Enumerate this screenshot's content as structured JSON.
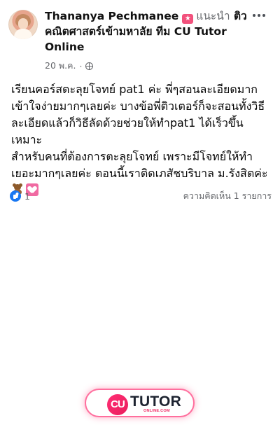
{
  "post": {
    "author_name": "Thananya Pechmanee",
    "recommendation_label": "แนะนำ",
    "page_name_prefix": "ติว",
    "page_name_line2": "คณิตศาสตร์เข้ามหาลัย ทีม CU Tutor",
    "page_name_line3": "Online",
    "date": "20 พ.ค.",
    "separator": "·",
    "visibility_icon": "globe-icon",
    "body": "เรียนคอร์สตะลุยโจทย์ pat1 ค่ะ พี่ๆสอนละเอียดมาก\nเข้าใจง่ายมากๆเลยค่ะ บางข้อพี่ติวเตอร์ก็จะสอนทั้งวิธี\nละเอียดแล้วก็วิธีลัดด้วยช่วยให้ทำpat1 ได้เร็วขึ้น เหมาะ\nสำหรับคนที่ต้องการตะลุยโจทย์ เพราะมีโจทย์ให้ทำ\nเยอะมากๆเลยค่ะ ตอนนี้เราติดเภสัชบริบาล ม.รังสิตค่ะ",
    "emoji_1": "teddy-bear-icon",
    "emoji_2": "heart-box-icon",
    "like_count": "1",
    "comments_text": "ความคิดเห็น 1 รายการ"
  },
  "footer": {
    "logo_text": "CU",
    "brand_text": "TUTOR",
    "domain_text": "ONLINE.COM"
  },
  "colors": {
    "like_blue": "#1877f2",
    "accent_pink": "#f2517c",
    "cta_border": "#ff6e9d",
    "brand_red": "#ea1d5d"
  }
}
